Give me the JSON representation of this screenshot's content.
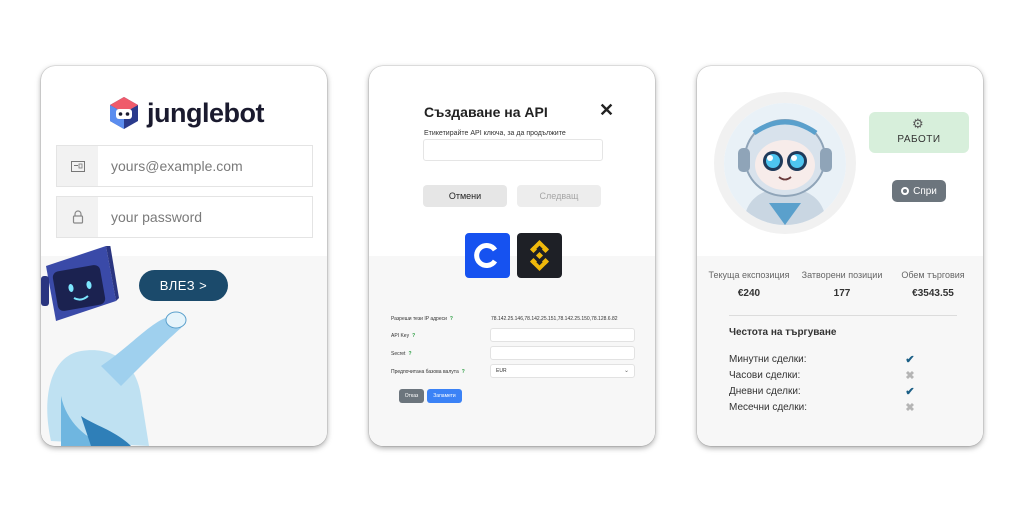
{
  "login": {
    "brand": "junglebot",
    "email_placeholder": "yours@example.com",
    "password_placeholder": "your password",
    "login_label": "ВЛЕЗ >"
  },
  "api": {
    "title": "Създаване на API",
    "close": "✕",
    "subtitle": "Етикетирайте API ключа, за да продължите",
    "cancel_label": "Отмени",
    "next_label": "Следващ",
    "exchanges": [
      "coinbase-icon",
      "binance-icon"
    ],
    "allow_ip_label": "Разреши тези IP адреси",
    "allow_ip_value": "78.142.25.146,78.142.25.151,78.142.25.150,78.128.6.82",
    "api_key_label": "API Key",
    "secret_label": "Secret",
    "currency_label": "Предпочитана базова валута",
    "currency_value": "EUR",
    "help": "?",
    "small_cancel": "Отказ",
    "save_label": "Запамети"
  },
  "bot": {
    "work_label": "РАБОТИ",
    "stop_label": "Спри",
    "stats": [
      {
        "label": "Текуща експозиция",
        "value": "€240"
      },
      {
        "label": "Затворени позиции",
        "value": "177"
      },
      {
        "label": "Обем търговия",
        "value": "€3543.55"
      }
    ],
    "freq_title": "Честота на търгуване",
    "freq": [
      {
        "label": "Минутни сделки:",
        "mark": "✔",
        "on": true
      },
      {
        "label": "Часови сделки:",
        "mark": "✖",
        "on": false
      },
      {
        "label": "Дневни сделки:",
        "mark": "✔",
        "on": true
      },
      {
        "label": "Месечни сделки:",
        "mark": "✖",
        "on": false
      }
    ]
  },
  "colors": {
    "primary": "#1b4a6b",
    "accent_green": "#d7efdb",
    "coinbase": "#1652f0",
    "binance_yellow": "#f0b90b"
  }
}
